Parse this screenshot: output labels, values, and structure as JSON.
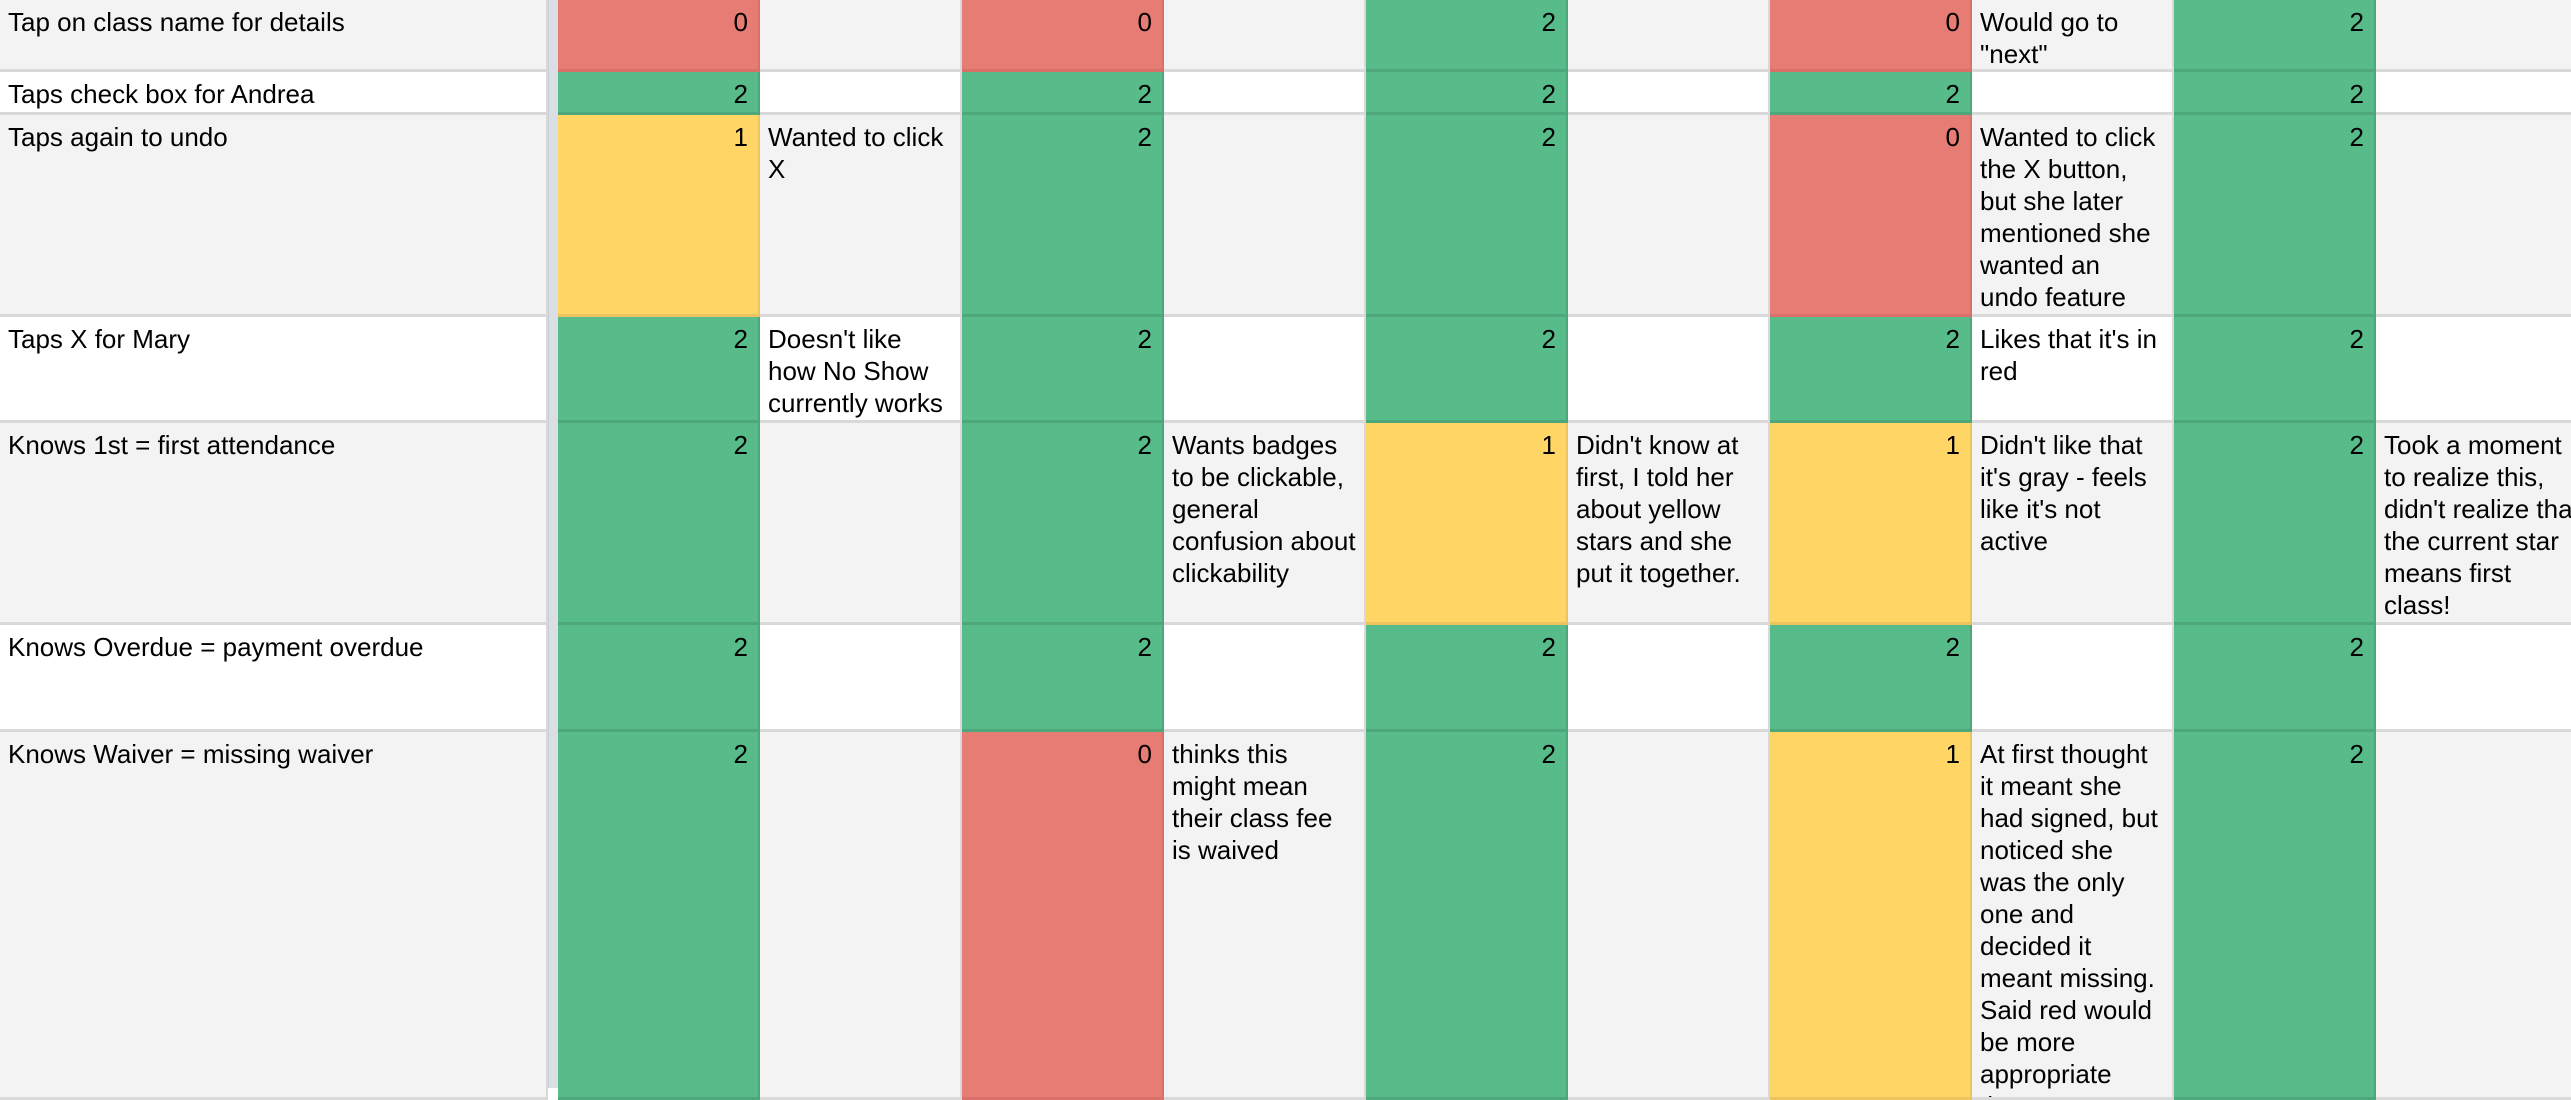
{
  "sheet": {
    "colors": {
      "score_0": "#e67c73",
      "score_1": "#ffd666",
      "score_2": "#57bb8a",
      "row_alt": "#f3f3f3"
    },
    "rows": [
      {
        "label": "Tap on class name for details",
        "participants": [
          {
            "score": "0",
            "comment": ""
          },
          {
            "score": "0",
            "comment": ""
          },
          {
            "score": "2",
            "comment": ""
          },
          {
            "score": "0",
            "comment": "Would go to \"next\""
          },
          {
            "score": "2",
            "comment": ""
          }
        ]
      },
      {
        "label": "Taps check box for Andrea",
        "participants": [
          {
            "score": "2",
            "comment": ""
          },
          {
            "score": "2",
            "comment": ""
          },
          {
            "score": "2",
            "comment": ""
          },
          {
            "score": "2",
            "comment": ""
          },
          {
            "score": "2",
            "comment": ""
          }
        ]
      },
      {
        "label": "Taps again to undo",
        "participants": [
          {
            "score": "1",
            "comment": "Wanted to click X"
          },
          {
            "score": "2",
            "comment": ""
          },
          {
            "score": "2",
            "comment": ""
          },
          {
            "score": "0",
            "comment": "Wanted to click the X button, but she later mentioned she wanted an undo feature"
          },
          {
            "score": "2",
            "comment": ""
          }
        ]
      },
      {
        "label": "Taps X for Mary",
        "participants": [
          {
            "score": "2",
            "comment": "Doesn't like how No Show currently works"
          },
          {
            "score": "2",
            "comment": ""
          },
          {
            "score": "2",
            "comment": ""
          },
          {
            "score": "2",
            "comment": "Likes that it's in red"
          },
          {
            "score": "2",
            "comment": ""
          }
        ]
      },
      {
        "label": "Knows 1st = first attendance",
        "participants": [
          {
            "score": "2",
            "comment": ""
          },
          {
            "score": "2",
            "comment": "Wants badges to be clickable, general confusion about clickability"
          },
          {
            "score": "1",
            "comment": "Didn't know at first, I told her about yellow stars and she put it together."
          },
          {
            "score": "1",
            "comment": "Didn't like that it's gray - feels like it's not active"
          },
          {
            "score": "2",
            "comment": "Took a moment to realize this, didn't realize that the current star means first class!"
          }
        ]
      },
      {
        "label": "Knows Overdue = payment overdue",
        "participants": [
          {
            "score": "2",
            "comment": ""
          },
          {
            "score": "2",
            "comment": ""
          },
          {
            "score": "2",
            "comment": ""
          },
          {
            "score": "2",
            "comment": ""
          },
          {
            "score": "2",
            "comment": ""
          }
        ]
      },
      {
        "label": "Knows Waiver = missing waiver",
        "participants": [
          {
            "score": "2",
            "comment": ""
          },
          {
            "score": "0",
            "comment": "thinks this might mean their class fee is waived"
          },
          {
            "score": "2",
            "comment": ""
          },
          {
            "score": "1",
            "comment": "At first thought it meant she had signed, but noticed she was the only one and decided it meant missing. Said red would be more appropriate than"
          },
          {
            "score": "2",
            "comment": ""
          }
        ]
      }
    ]
  }
}
